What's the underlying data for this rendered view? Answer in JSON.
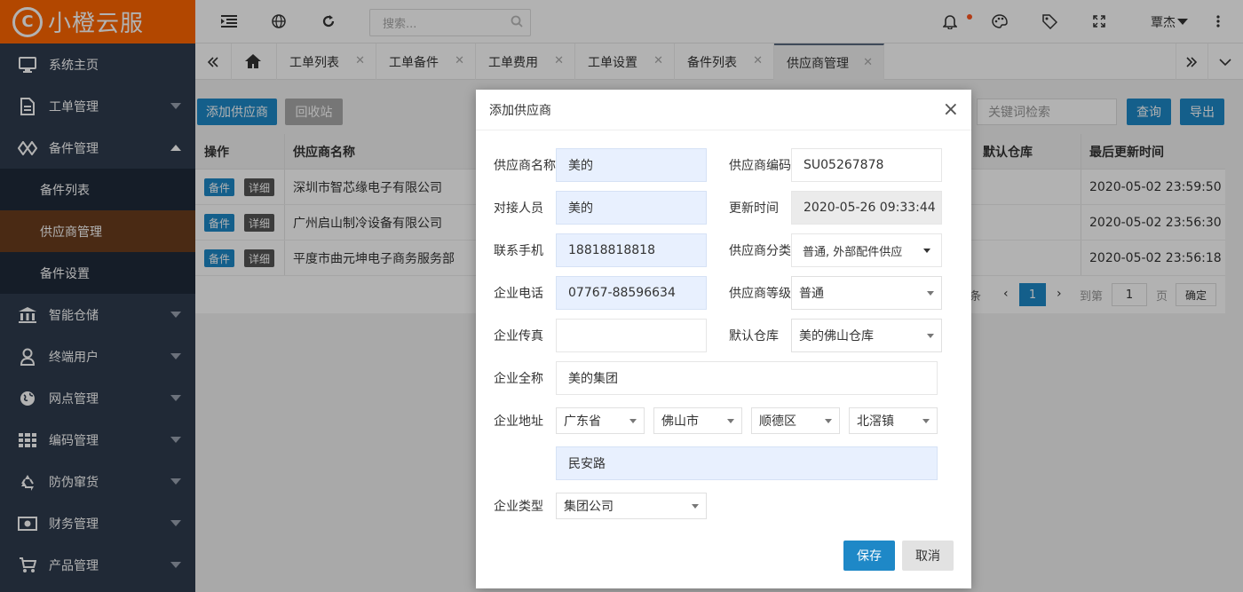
{
  "app": {
    "name": "小橙云服",
    "logo_char": "C"
  },
  "sidebar": {
    "items": [
      {
        "label": "系统主页",
        "icon": "monitor-icon"
      },
      {
        "label": "工单管理",
        "icon": "document-icon"
      },
      {
        "label": "备件管理",
        "icon": "diamond-icon"
      },
      {
        "label": "智能仓储",
        "icon": "bank-icon"
      },
      {
        "label": "终端用户",
        "icon": "user-icon"
      },
      {
        "label": "网点管理",
        "icon": "globe-icon"
      },
      {
        "label": "编码管理",
        "icon": "grid-icon"
      },
      {
        "label": "防伪窜货",
        "icon": "recycle-icon"
      },
      {
        "label": "财务管理",
        "icon": "money-icon"
      },
      {
        "label": "产品管理",
        "icon": "cart-icon"
      }
    ],
    "sub_items": [
      "备件列表",
      "供应商管理",
      "备件设置"
    ],
    "active_sub": "供应商管理"
  },
  "topbar": {
    "search_placeholder": "搜索...",
    "user": "覃杰"
  },
  "tabs": [
    {
      "label": "工单列表"
    },
    {
      "label": "工单备件"
    },
    {
      "label": "工单费用"
    },
    {
      "label": "工单设置"
    },
    {
      "label": "备件列表"
    },
    {
      "label": "供应商管理"
    }
  ],
  "toolbar": {
    "add_label": "添加供应商",
    "recycle_label": "回收站",
    "keyword_placeholder": "关键词检索",
    "query_label": "查询",
    "export_label": "导出"
  },
  "table": {
    "headers": {
      "op": "操作",
      "name": "供应商名称",
      "warehouse": "默认仓库",
      "updated": "最后更新时间"
    },
    "btn_parts": "备件",
    "btn_detail": "详细",
    "rows": [
      {
        "name": "深圳市智芯缘电子有限公司",
        "updated": "2020-05-02 23:59:50"
      },
      {
        "name": "广州启山制冷设备有限公司",
        "updated": "2020-05-02 23:56:30"
      },
      {
        "name": "平度市曲元坤电子商务服务部",
        "updated": "2020-05-02 23:56:18"
      }
    ],
    "pager": {
      "items_suffix": "条",
      "current": "1",
      "goto": "到第",
      "page_input": "1",
      "page": "页",
      "confirm": "确定"
    }
  },
  "modal": {
    "title": "添加供应商",
    "close": "×",
    "fields": {
      "name_label": "供应商名称",
      "name_value": "美的",
      "code_label": "供应商编码",
      "code_value": "SU05267878",
      "contact_label": "对接人员",
      "contact_value": "美的",
      "updated_label": "更新时间",
      "updated_value": "2020-05-26 09:33:44",
      "mobile_label": "联系手机",
      "mobile_value": "18818818818",
      "category_label": "供应商分类",
      "category_value": "普通, 外部配件供应",
      "phone_label": "企业电话",
      "phone_value": "07767-88596634",
      "level_label": "供应商等级",
      "level_value": "普通",
      "fax_label": "企业传真",
      "fax_value": "",
      "warehouse_label": "默认仓库",
      "warehouse_value": "美的佛山仓库",
      "fullname_label": "企业全称",
      "fullname_value": "美的集团",
      "address_label": "企业地址",
      "province": "广东省",
      "city": "佛山市",
      "district": "顺德区",
      "town": "北滘镇",
      "street": "民安路",
      "type_label": "企业类型",
      "type_value": "集团公司"
    },
    "save_label": "保存",
    "cancel_label": "取消"
  },
  "colors": {
    "brand": "#ff6600",
    "sidebar": "#2e3b4e",
    "primary": "#1e88c7",
    "active_sub": "#6b3d1e"
  }
}
